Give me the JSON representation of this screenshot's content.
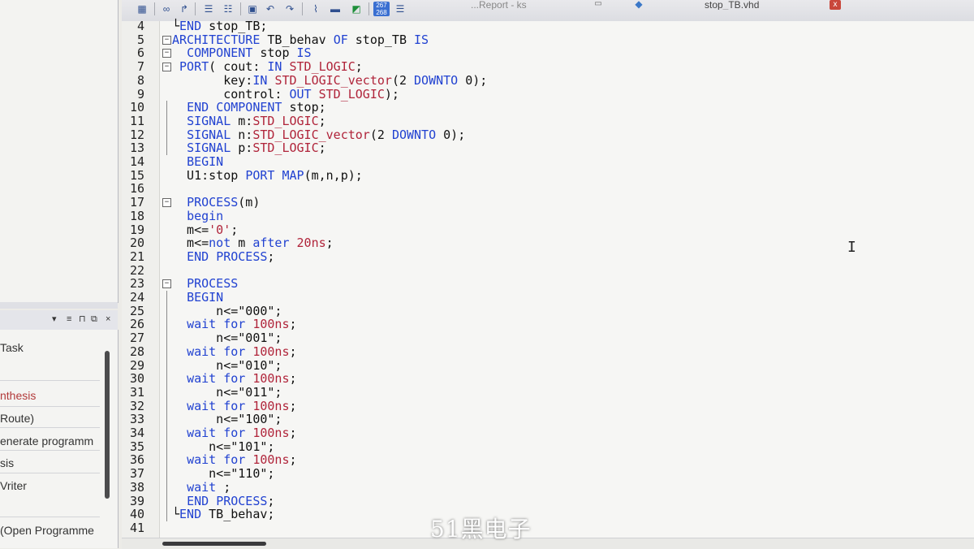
{
  "tabs": {
    "left_tab": "...Report - ks",
    "active_tab": "stop_TB.vhd",
    "close_glyph": "x"
  },
  "toolbar": {
    "icons": [
      "find-icon",
      "jump-icon",
      "indent-icon",
      "outdent-icon",
      "bookmark-icon",
      "bookmark-prev-icon",
      "bookmark-next-icon",
      "attach-icon",
      "comment-icon",
      "language-template-icon",
      "line-number-icon",
      "list-icon"
    ]
  },
  "left_panel": {
    "header_icons": [
      "dropdown-icon",
      "list-view-icon",
      "pin-icon",
      "float-icon",
      "close-icon"
    ],
    "tasks": [
      {
        "label": "Task",
        "highlight": false
      },
      {
        "label": "nthesis",
        "highlight": true
      },
      {
        "label": " Route)",
        "highlight": false
      },
      {
        "label": "enerate programm",
        "highlight": false
      },
      {
        "label": "sis",
        "highlight": false
      },
      {
        "label": "Vriter",
        "highlight": false
      },
      {
        "label": "(Open Programme",
        "highlight": false
      }
    ]
  },
  "editor": {
    "line_numbers": [
      "4",
      "5",
      "6",
      "7",
      "8",
      "9",
      "10",
      "11",
      "12",
      "13",
      "14",
      "15",
      "16",
      "17",
      "18",
      "19",
      "20",
      "21",
      "22",
      "23",
      "24",
      "25",
      "26",
      "27",
      "28",
      "29",
      "30",
      "31",
      "32",
      "33",
      "34",
      "35",
      "36",
      "37",
      "38",
      "39",
      "40",
      "41"
    ],
    "lines": [
      "└END stop_TB;",
      "ARCHITECTURE TB_behav OF stop_TB IS",
      "  COMPONENT stop IS",
      " PORT( cout: IN STD_LOGIC;",
      "       key:IN STD_LOGIC_vector(2 DOWNTO 0);",
      "       control: OUT STD_LOGIC);",
      "  END COMPONENT stop;",
      "  SIGNAL m:STD_LOGIC;",
      "  SIGNAL n:STD_LOGIC_vector(2 DOWNTO 0);",
      "  SIGNAL p:STD_LOGIC;",
      "  BEGIN",
      "  U1:stop PORT MAP(m,n,p);",
      "",
      "  PROCESS(m)",
      "  begin",
      "  m<='0';",
      "  m<=not m after 20ns;",
      "  END PROCESS;",
      "",
      "  PROCESS",
      "  BEGIN",
      "      n<=\"000\";",
      "  wait for 100ns;",
      "      n<=\"001\";",
      "  wait for 100ns;",
      "      n<=\"010\";",
      "  wait for 100ns;",
      "      n<=\"011\";",
      "  wait for 100ns;",
      "      n<=\"100\";",
      "  wait for 100ns;",
      "     n<=\"101\";",
      "  wait for 100ns;",
      "     n<=\"110\";",
      "  wait ;",
      "  END PROCESS;",
      "└END TB_behav;",
      ""
    ]
  },
  "watermark": "51黑电子",
  "colors": {
    "keyword": "#2142d1",
    "type": "#b0243a",
    "text": "#111111",
    "task_highlight": "#b23a3a"
  }
}
